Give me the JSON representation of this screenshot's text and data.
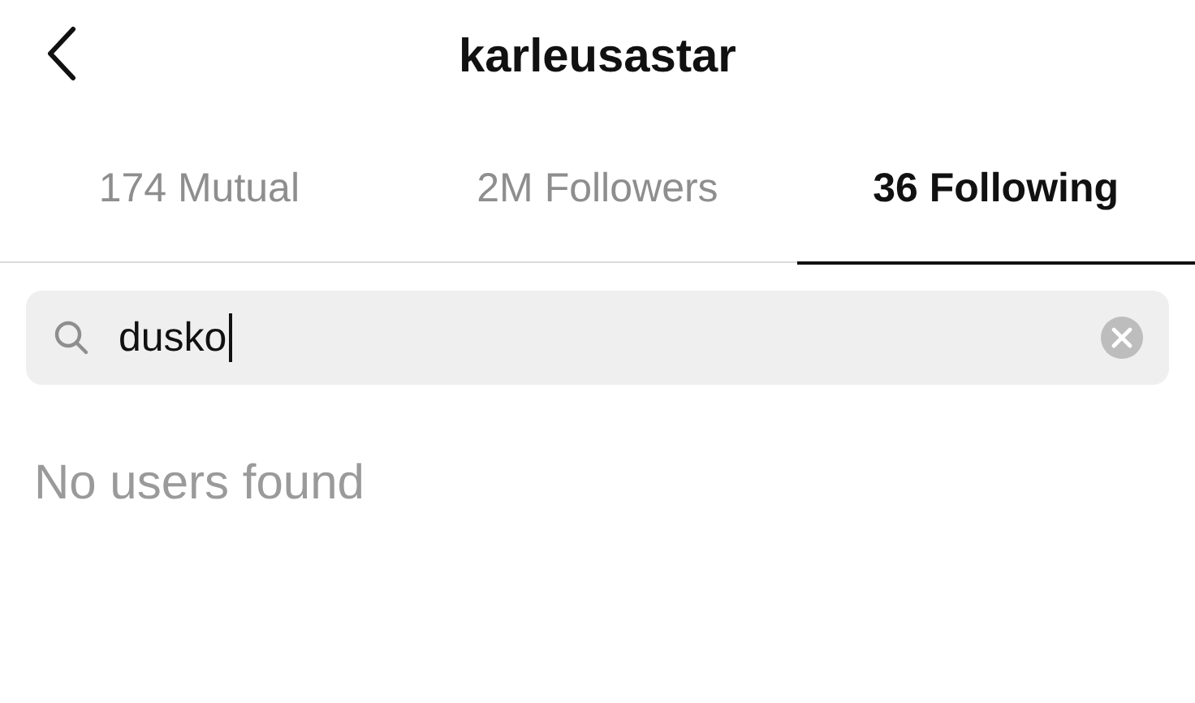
{
  "header": {
    "title": "karleusastar"
  },
  "tabs": [
    {
      "label": "174 Mutual",
      "selected": false
    },
    {
      "label": "2M Followers",
      "selected": false
    },
    {
      "label": "36 Following",
      "selected": true
    }
  ],
  "search": {
    "value": "dusko"
  },
  "empty_message": "No users found"
}
